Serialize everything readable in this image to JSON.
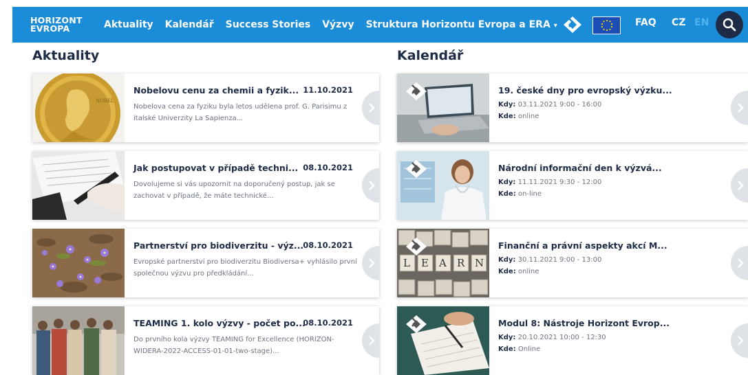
{
  "nav": {
    "brand_line1": "HORIZONT",
    "brand_line2": "EVROPA",
    "links": [
      "Aktuality",
      "Kalendář",
      "Success Stories",
      "Výzvy",
      "Struktura Horizontu Evropa a ERA"
    ],
    "dropdown_caret": "▾",
    "faq": "FAQ",
    "lang_cz": "CZ",
    "lang_en": "EN"
  },
  "news": {
    "title": "Aktuality",
    "items": [
      {
        "title": "Nobelovu cenu za chemii a fyzik...",
        "date": "11.10.2021",
        "excerpt": "Nobelova cena za fyziku byla letos udělena prof. G. Parisimu z italské Univerzity La Sapienza..."
      },
      {
        "title": "Jak postupovat v případě techni...",
        "date": "08.10.2021",
        "excerpt": "Dovolujeme si vás upozornit na doporučený postup, jak se zachovat v případě, že máte technické..."
      },
      {
        "title": "Partnerství pro biodiverzitu - výz...",
        "date": "08.10.2021",
        "excerpt": "Evropské partnerství pro biodiverzitu Biodiversa+ vyhlásilo první společnou výzvu pro předkládání..."
      },
      {
        "title": "TEAMING 1. kolo výzvy - počet po...",
        "date": "08.10.2021",
        "excerpt": "Do prvního kola výzvy TEAMING for Excellence (HORIZON-WIDERA-2022-ACCESS-01-01-two-stage)..."
      }
    ]
  },
  "calendar": {
    "title": "Kalendář",
    "when_label": "Kdy:",
    "where_label": "Kde:",
    "items": [
      {
        "title": "19. české dny pro evropský výzku...",
        "when": "03.11.2021 9:00 - 16:00",
        "where": "online"
      },
      {
        "title": "Národní informační den k výzvá...",
        "when": "11.11.2021 9:30 - 12:00",
        "where": "on-line"
      },
      {
        "title": "Finanční a právní aspekty akcí M...",
        "when": "30.11.2021 9:00 - 13:00",
        "where": "online"
      },
      {
        "title": "Modul 8: Nástroje Horizont Evrop...",
        "when": "20.10.2021 10:00 - 12:30",
        "where": "Online"
      }
    ]
  },
  "scrabble_tiles": [
    "L",
    "E",
    "A",
    "R",
    "N"
  ],
  "colors": {
    "navbar": "#1a8cd8",
    "navy": "#1d2b47",
    "eu_blue": "#1c4eb6",
    "en_inactive": "#4eb3ee"
  }
}
